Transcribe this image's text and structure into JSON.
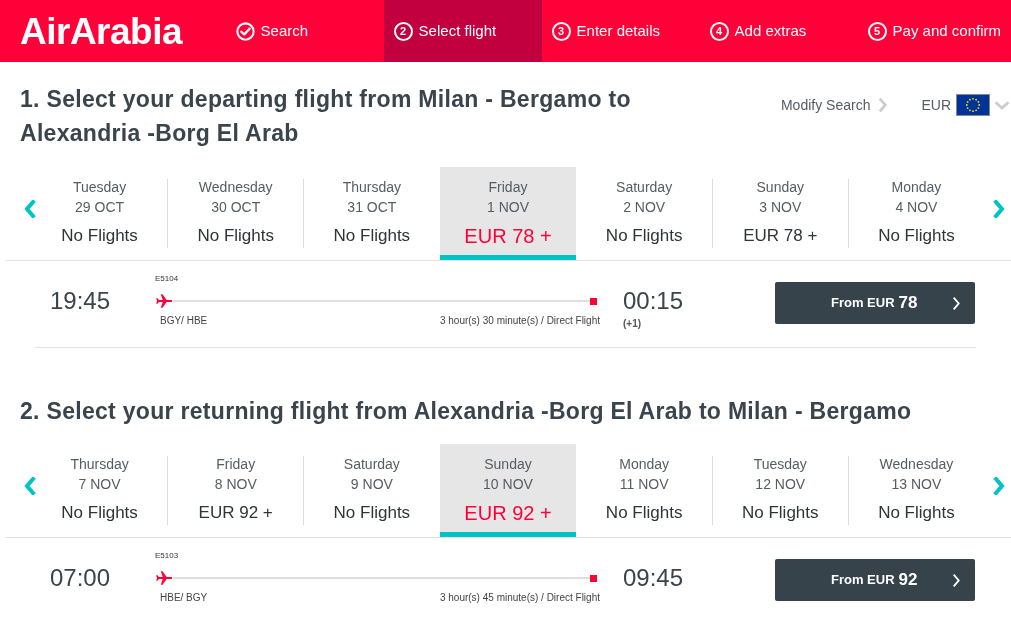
{
  "header": {
    "logo": "AirArabia",
    "steps": [
      {
        "kind": "done",
        "label": "Search",
        "selected": false
      },
      {
        "kind": "numbered",
        "number": "2",
        "label": "Select flight",
        "selected": true
      },
      {
        "kind": "numbered",
        "number": "3",
        "label": "Enter details",
        "selected": false
      },
      {
        "kind": "numbered",
        "number": "4",
        "label": "Add extras",
        "selected": false
      },
      {
        "kind": "numbered",
        "number": "5",
        "label": "Pay and confirm",
        "selected": false
      }
    ]
  },
  "sections": [
    {
      "number": "1.",
      "title": "Select your departing flight from Milan - Bergamo to Alexandria -Borg El Arab",
      "modify_search": "Modify Search",
      "currency": "EUR",
      "dates": [
        {
          "day": "Tuesday",
          "date": "29 OCT",
          "fare": "No Flights",
          "selected": false
        },
        {
          "day": "Wednesday",
          "date": "30 OCT",
          "fare": "No Flights",
          "selected": false
        },
        {
          "day": "Thursday",
          "date": "31 OCT",
          "fare": "No Flights",
          "selected": false
        },
        {
          "day": "Friday",
          "date": "1 NOV",
          "fare": "EUR 78 +",
          "selected": true
        },
        {
          "day": "Saturday",
          "date": "2 NOV",
          "fare": "No Flights",
          "selected": false
        },
        {
          "day": "Sunday",
          "date": "3 NOV",
          "fare": "EUR 78 +",
          "selected": false
        },
        {
          "day": "Monday",
          "date": "4 NOV",
          "fare": "No Flights",
          "selected": false
        }
      ],
      "flights": [
        {
          "flight_number": "E5104",
          "departure": "19:45",
          "arrival": "00:15",
          "day_offset": "(+1)",
          "route": "BGY/ HBE",
          "duration": "3 hour(s) 30 minute(s) / Direct Flight",
          "button_label": "From EUR",
          "button_price": "78"
        }
      ]
    },
    {
      "number": "2.",
      "title": "Select your returning flight from Alexandria -Borg El Arab to Milan - Bergamo",
      "dates": [
        {
          "day": "Thursday",
          "date": "7 NOV",
          "fare": "No Flights",
          "selected": false
        },
        {
          "day": "Friday",
          "date": "8 NOV",
          "fare": "EUR 92 +",
          "selected": false
        },
        {
          "day": "Saturday",
          "date": "9 NOV",
          "fare": "No Flights",
          "selected": false
        },
        {
          "day": "Sunday",
          "date": "10 NOV",
          "fare": "EUR 92 +",
          "selected": true
        },
        {
          "day": "Monday",
          "date": "11 NOV",
          "fare": "No Flights",
          "selected": false
        },
        {
          "day": "Tuesday",
          "date": "12 NOV",
          "fare": "No Flights",
          "selected": false
        },
        {
          "day": "Wednesday",
          "date": "13 NOV",
          "fare": "No Flights",
          "selected": false
        }
      ],
      "flights": [
        {
          "flight_number": "E5103",
          "departure": "07:00",
          "arrival": "09:45",
          "route": "HBE/ BGY",
          "duration": "3 hour(s) 45 minute(s) / Direct Flight",
          "button_label": "From EUR",
          "button_price": "92"
        }
      ]
    }
  ]
}
